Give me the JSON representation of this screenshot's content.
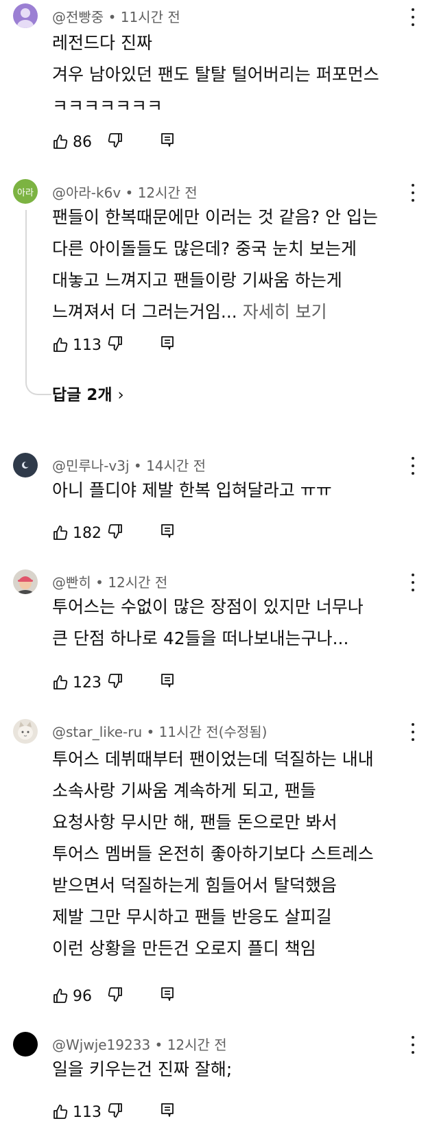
{
  "comments": [
    {
      "author": "@전빵중",
      "time": "11시간 전",
      "lines": [
        "레전드다 진짜",
        "겨우 남아있던 팬도 탈탈 털어버리는 퍼포먼스",
        "ㅋㅋㅋㅋㅋㅋㅋ"
      ],
      "likes": "86",
      "avatar": "purple-person-avatar"
    },
    {
      "author": "@아라-k6v",
      "time": "12시간 전",
      "avatar_text": "아라",
      "lines": [
        "팬들이 한복때문에만 이러는 것 같음? 안 입는",
        "다른 아이돌들도 많은데? 중국 눈치 보는게",
        "대놓고 느껴지고 팬들이랑 기싸움 하는게",
        "느껴져서 더 그러는거임..."
      ],
      "more_label": "자세히 보기",
      "likes": "113",
      "replies_label": "답글 2개",
      "avatar": "green-text-avatar"
    },
    {
      "author": "@민루나-v3j",
      "time": "14시간 전",
      "lines": [
        "아니 플디야 제발 한복 입혀달라고 ㅠㅠ"
      ],
      "likes": "182",
      "avatar": "dark-moon-avatar"
    },
    {
      "author": "@빤히",
      "time": "12시간 전",
      "lines": [
        "투어스는 수없이 많은 장점이 있지만 너무나",
        "큰 단점 하나로 42들을 떠나보내는구나..."
      ],
      "likes": "123",
      "avatar": "person-cap-avatar"
    },
    {
      "author": "@star_like-ru",
      "time": "11시간 전(수정됨)",
      "lines": [
        "투어스 데뷔때부터 팬이었는데 덕질하는 내내",
        "소속사랑 기싸움 계속하게 되고, 팬들",
        "요청사항 무시만 해, 팬들 돈으로만 봐서",
        "투어스 멤버들 온전히 좋아하기보다 스트레스",
        "받으면서 덕질하는게 힘들어서 탈덕했음",
        "제발 그만 무시하고 팬들 반응도 살피길",
        "이런 상황을 만든건 오로지 플디 책임"
      ],
      "likes": "96",
      "avatar": "cat-avatar"
    },
    {
      "author": "@Wjwje19233",
      "time": "12시간 전",
      "lines": [
        "일을 키우는건 진짜 잘해;"
      ],
      "likes": "113",
      "avatar": "black-avatar"
    }
  ],
  "colors": {
    "text": "#0f0f0f",
    "meta": "#606060",
    "avatar_purple": "#a98bd9",
    "avatar_green": "#7cb342",
    "avatar_dark": "#2f3a4a",
    "avatar_black": "#000000"
  }
}
